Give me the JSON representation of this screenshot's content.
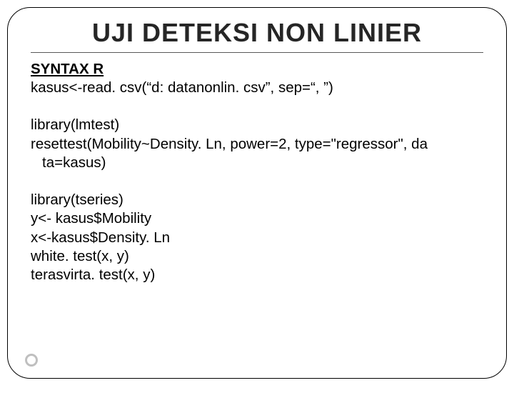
{
  "title": "UJI DETEKSI NON LINIER",
  "sections": {
    "syntax_header": "SYNTAX R",
    "read_line": "kasus<-read. csv(“d: datanonlin. csv”, sep=“, ”)",
    "lmtest_lib": "library(lmtest)",
    "resettest_l1": "resettest(Mobility~Density. Ln, power=2, type=\"regressor\", da",
    "resettest_l2": "ta=kasus)",
    "tseries_lib": "library(tseries)",
    "y_line": "y<- kasus$Mobility",
    "x_line": "x<-kasus$Density. Ln",
    "white_line": "white. test(x, y)",
    "teras_line": "terasvirta. test(x, y)"
  }
}
